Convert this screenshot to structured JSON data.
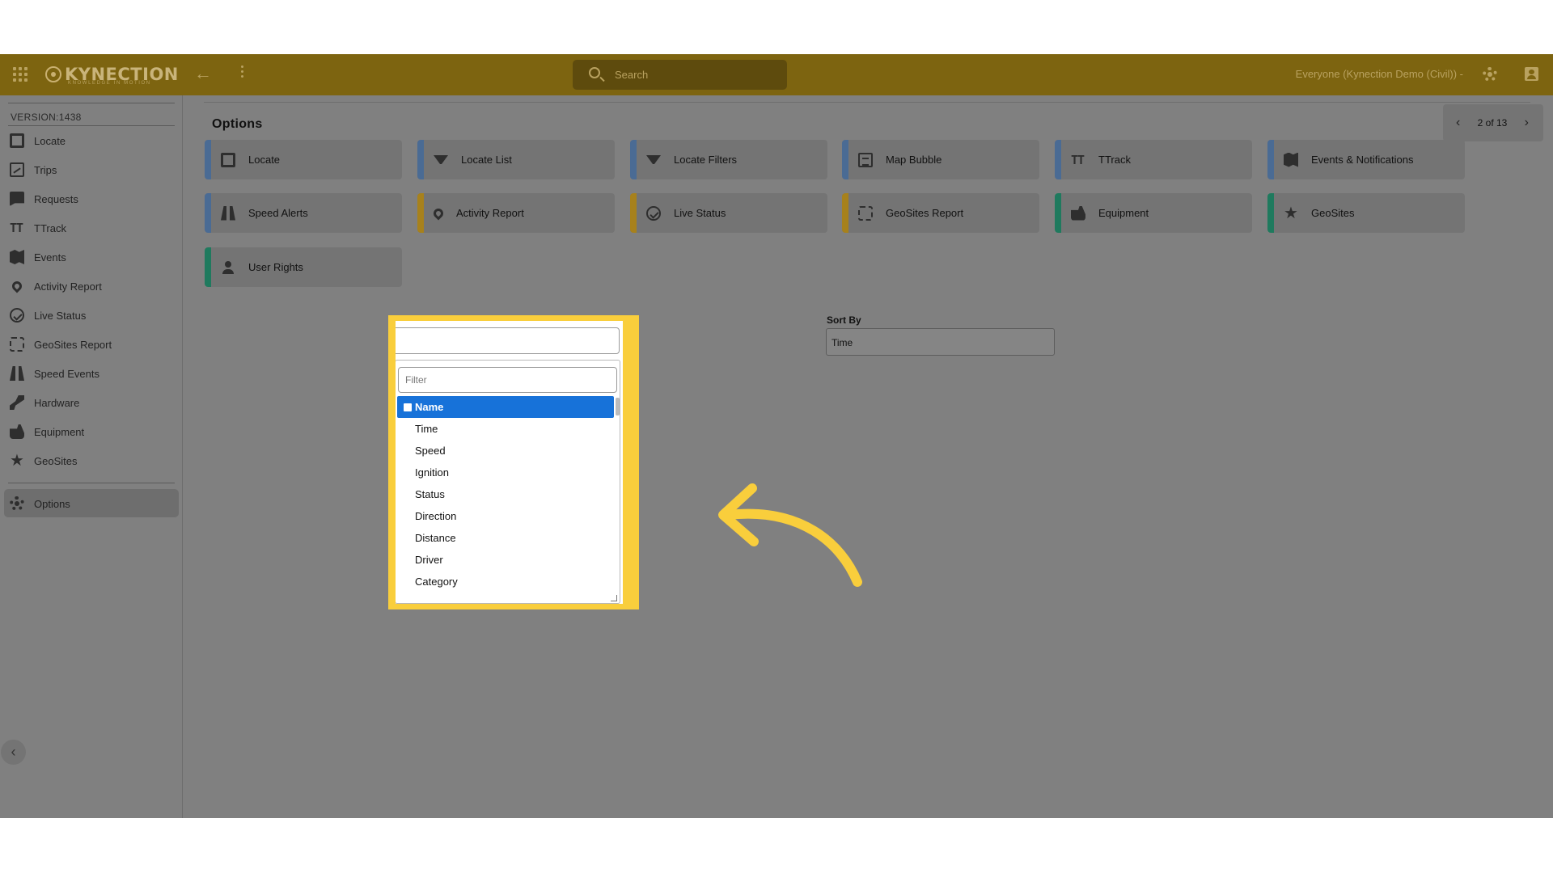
{
  "topbar": {
    "logo_text": "KYNECTION",
    "logo_tagline": "KNOWLEDGE IN MOTION",
    "search_placeholder": "Search",
    "org_selector": "Everyone (Kynection Demo (Civil)) -"
  },
  "sidebar": {
    "version": "VERSION:1438",
    "items": [
      {
        "label": "Locate",
        "icon": "map-icon"
      },
      {
        "label": "Trips",
        "icon": "trips-icon"
      },
      {
        "label": "Requests",
        "icon": "requests-icon"
      },
      {
        "label": "TTrack",
        "icon": "ttrack-icon"
      },
      {
        "label": "Events",
        "icon": "events-icon"
      },
      {
        "label": "Activity Report",
        "icon": "pin-icon"
      },
      {
        "label": "Live Status",
        "icon": "check-circle-icon"
      },
      {
        "label": "GeoSites Report",
        "icon": "dashed-square-icon"
      },
      {
        "label": "Speed Events",
        "icon": "road-icon"
      },
      {
        "label": "Hardware",
        "icon": "tool-icon"
      },
      {
        "label": "Equipment",
        "icon": "truck-icon"
      },
      {
        "label": "GeoSites",
        "icon": "star-icon"
      }
    ],
    "active_item": {
      "label": "Options",
      "icon": "gear-icon"
    },
    "collapse_glyph": "‹"
  },
  "main": {
    "title": "Options",
    "pager": {
      "text": "2 of 13",
      "prev": "‹",
      "next": "›"
    },
    "cards": [
      {
        "label": "Locate",
        "accent": "#4a6b94",
        "icon": "map-icon"
      },
      {
        "label": "Locate List",
        "accent": "#4a6b94",
        "icon": "filter-icon"
      },
      {
        "label": "Locate Filters",
        "accent": "#4a6b94",
        "icon": "filter-icon"
      },
      {
        "label": "Map Bubble",
        "accent": "#4a6b94",
        "icon": "clipboard-icon"
      },
      {
        "label": "TTrack",
        "accent": "#4a6b94",
        "icon": "ttrack-icon"
      },
      {
        "label": "Events & Notifications",
        "accent": "#4a6b94",
        "icon": "events-icon"
      },
      {
        "label": "Speed Alerts",
        "accent": "#4a6b94",
        "icon": "road-icon"
      },
      {
        "label": "Activity Report",
        "accent": "#a7811c",
        "icon": "pin-icon"
      },
      {
        "label": "Live Status",
        "accent": "#a7811c",
        "icon": "check-circle-icon"
      },
      {
        "label": "GeoSites Report",
        "accent": "#a7811c",
        "icon": "dashed-square-icon"
      },
      {
        "label": "Equipment",
        "accent": "#1f7a5e",
        "icon": "truck-icon"
      },
      {
        "label": "GeoSites",
        "accent": "#1f7a5e",
        "icon": "star-icon"
      },
      {
        "label": "User Rights",
        "accent": "#1f7a5e",
        "icon": "person-icon"
      }
    ],
    "sort_by": {
      "label": "Sort By",
      "value": "Time"
    }
  },
  "dropdown": {
    "filter_placeholder": "Filter",
    "options": [
      "Name",
      "Time",
      "Speed",
      "Ignition",
      "Status",
      "Direction",
      "Distance",
      "Driver",
      "Category"
    ],
    "selected": "Name",
    "highlight_color": "#f9ce3c",
    "selected_color": "#1772d9"
  },
  "annotation": {
    "arrow_color": "#f9ce3c"
  }
}
